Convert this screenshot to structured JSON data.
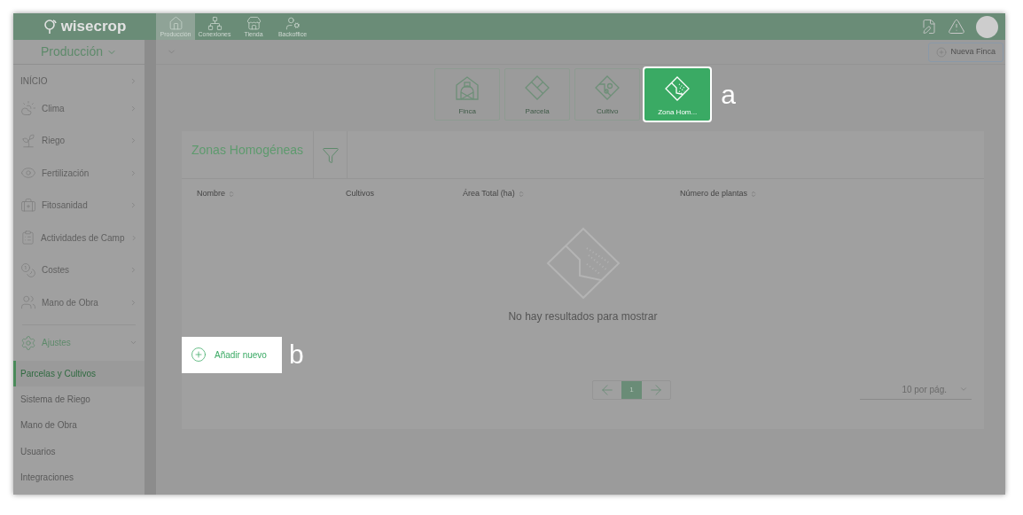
{
  "app": {
    "logo": "wisecrop"
  },
  "modules": [
    {
      "label": "Producción",
      "selected": true
    },
    {
      "label": "Conexiones",
      "selected": false
    },
    {
      "label": "Tienda",
      "selected": false
    },
    {
      "label": "Backoffice",
      "selected": false
    }
  ],
  "sidebar": {
    "title": "Producción",
    "items": [
      {
        "label": "INÍCIO"
      },
      {
        "label": "Clima"
      },
      {
        "label": "Riego"
      },
      {
        "label": "Fertilización"
      },
      {
        "label": "Fitosanidad"
      },
      {
        "label": "Actividades de Camp"
      },
      {
        "label": "Costes"
      },
      {
        "label": "Mano de Obra"
      }
    ],
    "section": {
      "label": "Ajustes",
      "expanded": true,
      "children": [
        {
          "label": "Parcelas y Cultivos",
          "selected": true
        },
        {
          "label": "Sistema de Riego",
          "selected": false
        },
        {
          "label": "Mano de Obra",
          "selected": false
        },
        {
          "label": "Usuarios",
          "selected": false
        },
        {
          "label": "Integraciones",
          "selected": false
        }
      ]
    }
  },
  "toolbar": {
    "new_button": "Nueva Finca"
  },
  "entity_tabs": [
    {
      "label": "Finca",
      "selected": false
    },
    {
      "label": "Parcela",
      "selected": false
    },
    {
      "label": "Cultivo",
      "selected": false
    },
    {
      "label": "Zona Hom...",
      "selected": true,
      "callout": "a"
    }
  ],
  "panel": {
    "title": "Zonas Homogéneas",
    "columns": [
      {
        "label": "Nombre",
        "sortable": true
      },
      {
        "label": "Cultivos",
        "sortable": false
      },
      {
        "label": "Área Total (ha)",
        "sortable": true
      },
      {
        "label": "Número de plantas",
        "sortable": true
      }
    ],
    "empty_message": "No hay resultados para mostrar",
    "add_button": {
      "label": "Añadir nuevo",
      "callout": "b"
    },
    "pages": [
      {
        "label": "1",
        "selected": true
      }
    ],
    "page_size": "10 por pág."
  }
}
